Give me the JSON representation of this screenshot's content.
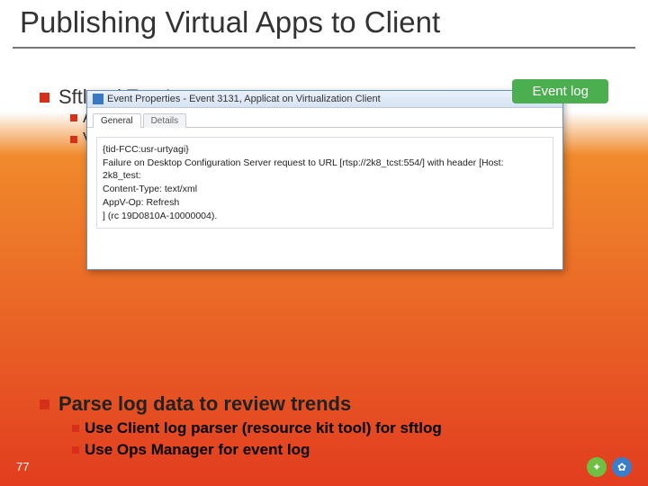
{
  "title": "Publishing Virtual Apps to Client",
  "bullet1": "Sftlog /  Eve  I",
  "sub_a": "A",
  "sub_v": "V",
  "eventlog_label": "Event log",
  "dialog": {
    "title": "Event Properties - Event 3131, Applicat on Virtualization Client",
    "tab_general": "General",
    "tab_details": "Details",
    "line1": "{tid-FCC:usr-urtyagi}",
    "line2": "Failure on Desktop Configuration Server request to URL [rtsp://2k8_tcst:554/] with header [Host:",
    "line3": "2k8_test:",
    "line4": "Content-Type: text/xml",
    "line5": "AppV-Op: Refresh",
    "line6": "] (rc 19D0810A-10000004)."
  },
  "low1": "Parse log data to review trends",
  "low2": "Use Client log parser (resource kit tool) for sftlog",
  "low3": "Use Ops Manager for event log",
  "page": "77",
  "icon_bulb": "✦",
  "icon_gear": "✿"
}
